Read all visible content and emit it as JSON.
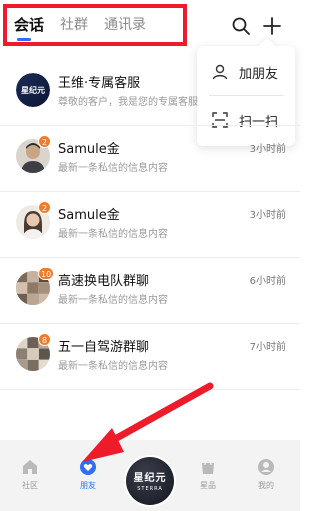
{
  "header": {
    "tabs": [
      {
        "label": "会话",
        "active": true
      },
      {
        "label": "社群",
        "active": false
      },
      {
        "label": "通讯录",
        "active": false
      }
    ],
    "search_icon": "search-icon",
    "plus_icon": "plus-icon"
  },
  "dropdown": {
    "items": [
      {
        "label": "加朋友",
        "icon": "person-icon"
      },
      {
        "label": "扫一扫",
        "icon": "scan-icon"
      }
    ]
  },
  "conversations": [
    {
      "name": "王维·专属客服",
      "message": "尊敬的客户，我是您的专属客服",
      "time": "",
      "badge": "",
      "avatar": "logo",
      "avatar_text": "星纪元"
    },
    {
      "name": "Samule金",
      "message": "最新一条私信的信息内容",
      "time": "3小时前",
      "badge": "2",
      "avatar": "person-man"
    },
    {
      "name": "Samule金",
      "message": "最新一条私信的信息内容",
      "time": "3小时前",
      "badge": "2",
      "avatar": "person-woman"
    },
    {
      "name": "高速换电队群聊",
      "message": "最新一条私信的信息内容",
      "time": "6小时前",
      "badge": "10",
      "avatar": "group"
    },
    {
      "name": "五一自驾游群聊",
      "message": "最新一条私信的信息内容",
      "time": "7小时前",
      "badge": "8",
      "avatar": "group"
    }
  ],
  "bottom_nav": {
    "items": [
      {
        "label": "社区",
        "icon": "home-icon",
        "active": false
      },
      {
        "label": "朋友",
        "icon": "heart-chat-icon",
        "active": true
      },
      {
        "label": "星品",
        "icon": "bag-icon",
        "active": false
      },
      {
        "label": "我的",
        "icon": "profile-icon",
        "active": false
      }
    ],
    "center_logo": {
      "cn": "星纪元",
      "en": "STERRA"
    }
  },
  "colors": {
    "accent": "#2f6ef5",
    "badge": "#f07c2b",
    "annotation": "#ee1c2b"
  }
}
